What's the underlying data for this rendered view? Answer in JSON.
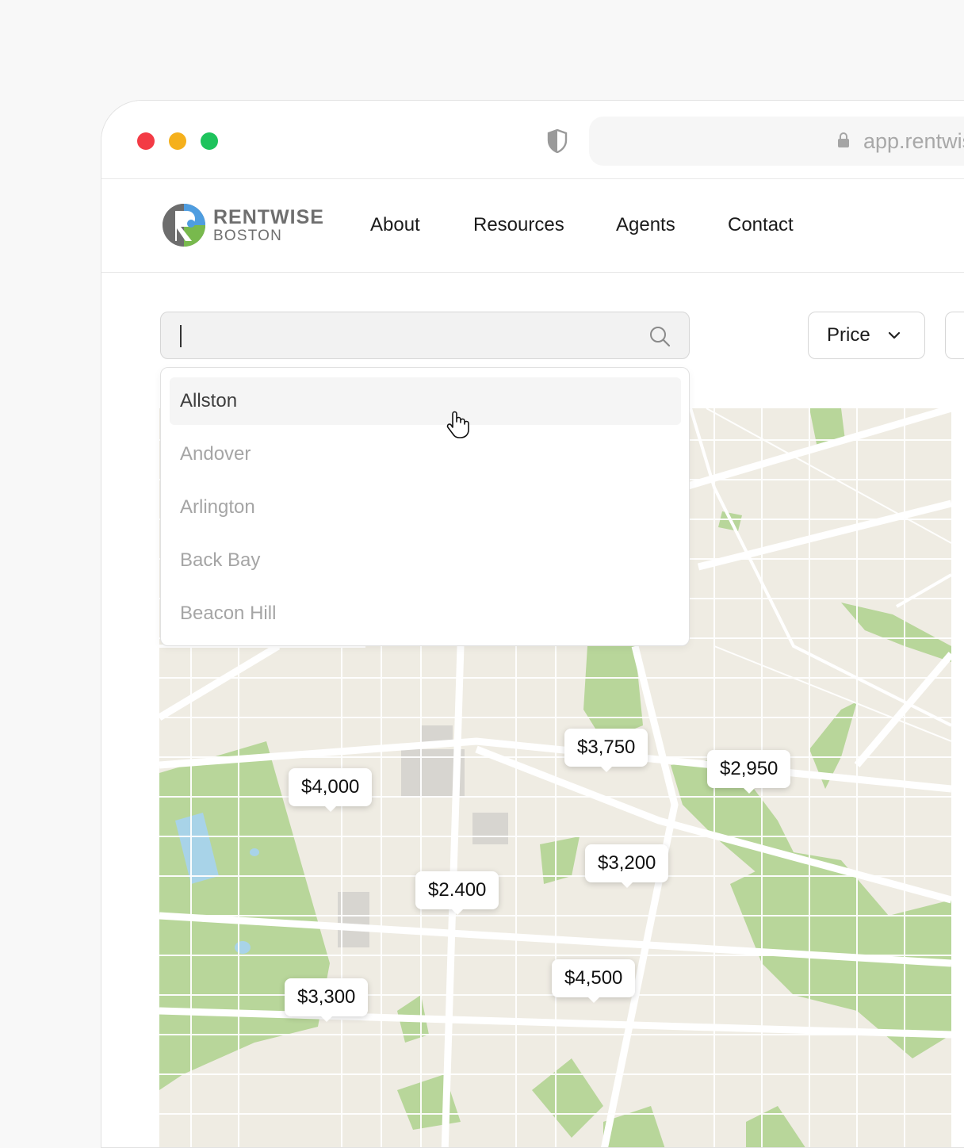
{
  "browser": {
    "url_text": "app.rentwise.com",
    "traffic_colors": {
      "close": "#f33b45",
      "minimize": "#f5b01c",
      "maximize": "#1ec35c"
    }
  },
  "brand": {
    "name": "RENTWISE",
    "sub": "BOSTON"
  },
  "nav": {
    "links": [
      "About",
      "Resources",
      "Agents",
      "Contact"
    ]
  },
  "search": {
    "value": "",
    "placeholder": ""
  },
  "filters": {
    "price_label": "Price"
  },
  "dropdown": {
    "items": [
      "Allston",
      "Andover",
      "Arlington",
      "Back Bay",
      "Beacon Hill"
    ],
    "highlighted_index": 0
  },
  "map": {
    "pins": [
      "$3,750",
      "$2,950",
      "$4,000",
      "$3,200",
      "$2.400",
      "$4,500",
      "$3,300"
    ]
  },
  "colors": {
    "park": "#b8d69a",
    "map_bg": "#efece3",
    "road": "#ffffff"
  }
}
